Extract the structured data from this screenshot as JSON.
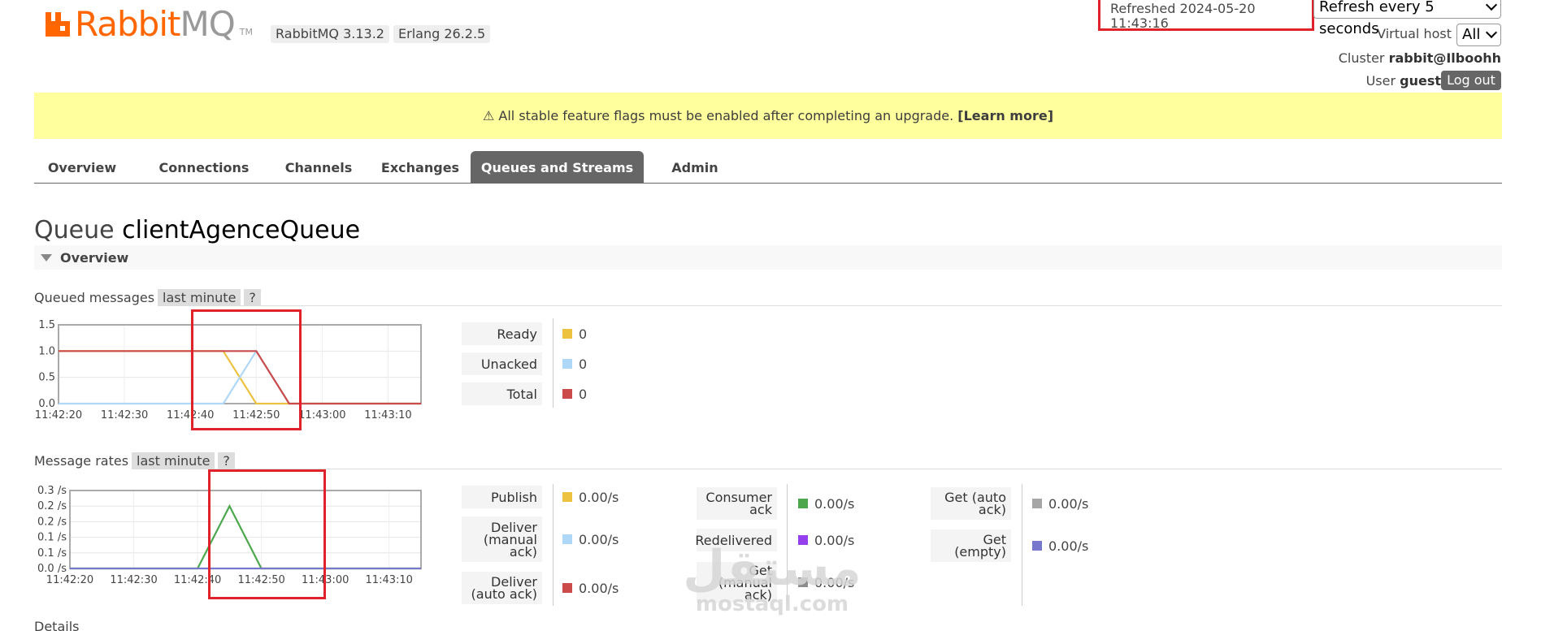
{
  "header": {
    "logo_text": "Rabbit",
    "logo_text_mq": "MQ",
    "logo_tm": "TM",
    "rabbitmq_version": "RabbitMQ 3.13.2",
    "erlang_version": "Erlang 26.2.5",
    "refreshed": "Refreshed 2024-05-20 11:43:16",
    "refresh_select": "Refresh every 5 seconds",
    "vhost_label": "Virtual host",
    "vhost_select": "All",
    "cluster_label": "Cluster",
    "cluster_name": "rabbit@Ilboohh",
    "user_label": "User",
    "user_name": "guest",
    "logout_label": "Log out"
  },
  "banner": {
    "text": "⚠ All stable feature flags must be enabled after completing an upgrade.",
    "link": "[Learn more]"
  },
  "tabs": [
    {
      "label": "Overview"
    },
    {
      "label": "Connections"
    },
    {
      "label": "Channels"
    },
    {
      "label": "Exchanges"
    },
    {
      "label": "Queues and Streams",
      "active": true
    },
    {
      "label": "Admin"
    }
  ],
  "queue": {
    "prefix": "Queue",
    "name": "clientAgenceQueue",
    "overview_label": "Overview"
  },
  "queued_messages": {
    "label": "Queued messages",
    "range": "last minute",
    "help": "?",
    "stats": [
      {
        "label": "Ready",
        "value": "0",
        "color": "#edc240"
      },
      {
        "label": "Unacked",
        "value": "0",
        "color": "#afd8f8"
      },
      {
        "label": "Total",
        "value": "0",
        "color": "#cb4b4b"
      }
    ]
  },
  "message_rates": {
    "label": "Message rates",
    "range": "last minute",
    "help": "?",
    "col1": [
      {
        "label": "Publish",
        "value": "0.00/s",
        "color": "#edc240"
      },
      {
        "label": "Deliver (manual ack)",
        "value": "0.00/s",
        "color": "#afd8f8"
      },
      {
        "label": "Deliver (auto ack)",
        "value": "0.00/s",
        "color": "#cb4b4b"
      }
    ],
    "col2": [
      {
        "label": "Consumer ack",
        "value": "0.00/s",
        "color": "#4da74d"
      },
      {
        "label": "Redelivered",
        "value": "0.00/s",
        "color": "#9440ed"
      },
      {
        "label": "Get (manual ack)",
        "value": "0.00/s",
        "color": "#8d8d8d"
      }
    ],
    "col3": [
      {
        "label": "Get (auto ack)",
        "value": "0.00/s",
        "color": "#a6a6a6"
      },
      {
        "label": "Get (empty)",
        "value": "0.00/s",
        "color": "#7777cc"
      }
    ]
  },
  "details_label": "Details",
  "watermark": {
    "arabic": "مستقل",
    "latin": "mostaql.com"
  },
  "chart_data": [
    {
      "type": "line",
      "x": [
        "11:42:20",
        "11:42:25",
        "11:42:30",
        "11:42:35",
        "11:42:40",
        "11:42:45",
        "11:42:50",
        "11:42:55",
        "11:43:00",
        "11:43:05",
        "11:43:10",
        "11:43:15"
      ],
      "xticks": [
        "11:42:20",
        "11:42:30",
        "11:42:40",
        "11:42:50",
        "11:43:00",
        "11:43:10"
      ],
      "yticks": [
        "0.0",
        "0.5",
        "1.0",
        "1.5"
      ],
      "ylim": [
        0,
        1.5
      ],
      "series": [
        {
          "name": "Ready",
          "color": "#edc240",
          "values": [
            1,
            1,
            1,
            1,
            1,
            1,
            0,
            0,
            0,
            0,
            0,
            0
          ]
        },
        {
          "name": "Unacked",
          "color": "#afd8f8",
          "values": [
            0,
            0,
            0,
            0,
            0,
            0,
            1,
            0,
            0,
            0,
            0,
            0
          ]
        },
        {
          "name": "Total",
          "color": "#cb4b4b",
          "values": [
            1,
            1,
            1,
            1,
            1,
            1,
            1,
            0,
            0,
            0,
            0,
            0
          ]
        }
      ]
    },
    {
      "type": "line",
      "x": [
        "11:42:20",
        "11:42:25",
        "11:42:30",
        "11:42:35",
        "11:42:40",
        "11:42:45",
        "11:42:50",
        "11:42:55",
        "11:43:00",
        "11:43:05",
        "11:43:10",
        "11:43:15"
      ],
      "xticks": [
        "11:42:20",
        "11:42:30",
        "11:42:40",
        "11:42:50",
        "11:43:00",
        "11:43:10"
      ],
      "yticks": [
        "0.0 /s",
        "0.1 /s",
        "0.1 /s",
        "0.2 /s",
        "0.2 /s",
        "0.3 /s"
      ],
      "ylim": [
        0,
        0.25
      ],
      "series": [
        {
          "name": "Consumer ack",
          "color": "#4da74d",
          "values": [
            0,
            0,
            0,
            0,
            0,
            0.2,
            0,
            0,
            0,
            0,
            0,
            0
          ]
        },
        {
          "name": "Publish",
          "color": "#7777cc",
          "values": [
            0,
            0,
            0,
            0,
            0,
            0,
            0,
            0,
            0,
            0,
            0,
            0
          ]
        }
      ]
    }
  ]
}
